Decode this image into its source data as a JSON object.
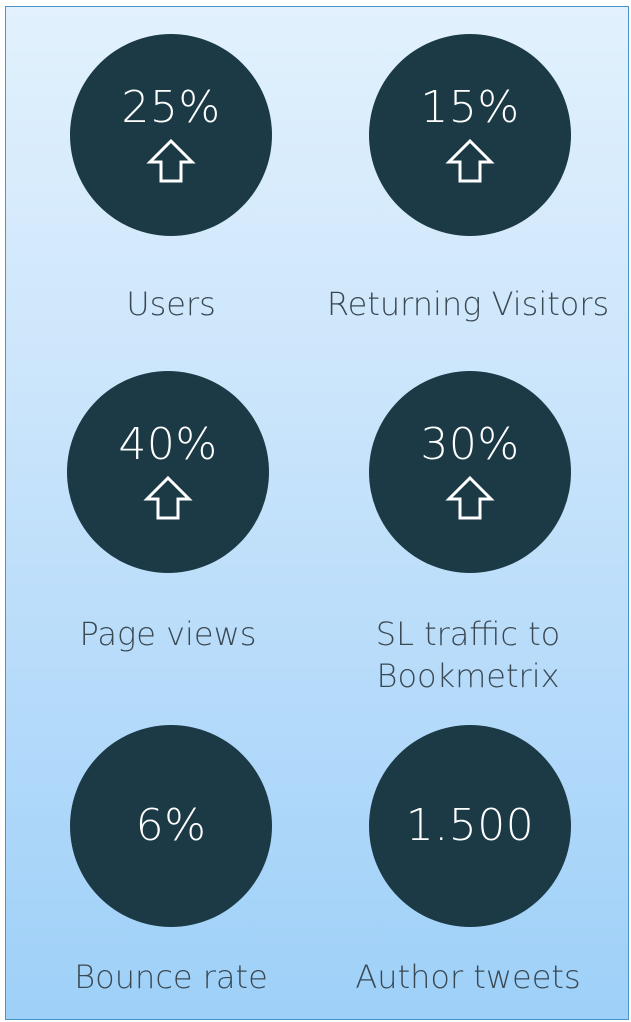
{
  "colors": {
    "circle_fill": "#1b3a45",
    "circle_text": "#ffffff",
    "label_text": "#3a4852",
    "panel_border": "#4a95c8"
  },
  "metrics": [
    {
      "value": "25%",
      "label": "Users",
      "icon": "up-arrow-icon"
    },
    {
      "value": "15%",
      "label": "Returning Visitors",
      "icon": "up-arrow-icon"
    },
    {
      "value": "40%",
      "label": "Page views",
      "icon": "up-arrow-icon"
    },
    {
      "value": "30%",
      "label_line1": "SL traffic to",
      "label_line2": "Bookmetrix",
      "icon": "up-arrow-icon"
    },
    {
      "value": "6%",
      "label": "Bounce rate"
    },
    {
      "value": "1.500",
      "label": "Author tweets"
    }
  ]
}
